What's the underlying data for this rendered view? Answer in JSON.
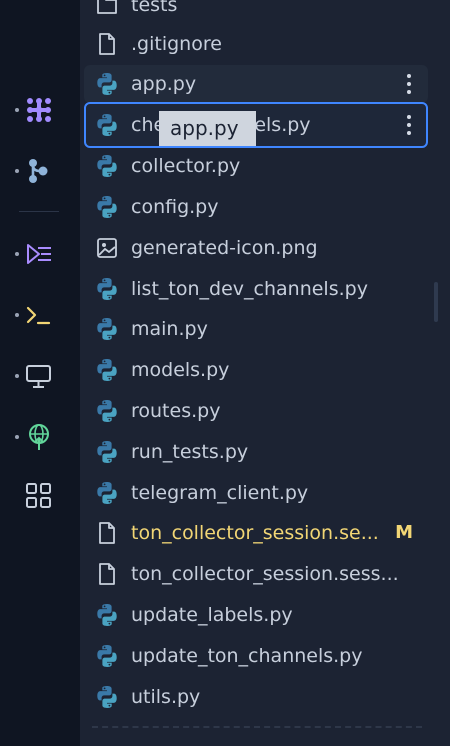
{
  "rail": {
    "items": [
      {
        "name": "agent-icon",
        "color": "#a18bff"
      },
      {
        "name": "git-icon",
        "color": "#8fb3d9"
      },
      {
        "name": "debugger-icon",
        "color": "#a98cff"
      },
      {
        "name": "shell-icon",
        "color": "#f2d675"
      },
      {
        "name": "console-icon",
        "color": "#c7cfdc"
      },
      {
        "name": "deployments-icon",
        "color": "#61d59a"
      },
      {
        "name": "all-tools-icon",
        "color": "#c7cfdc"
      }
    ]
  },
  "files": [
    {
      "name": "tests",
      "icon": "folder-icon"
    },
    {
      "name": ".gitignore",
      "icon": "file-icon"
    },
    {
      "name": "app.py",
      "icon": "python-icon",
      "state": "hovered"
    },
    {
      "name": "check_channels.py",
      "icon": "python-icon",
      "state": "selected"
    },
    {
      "name": "collector.py",
      "icon": "python-icon"
    },
    {
      "name": "config.py",
      "icon": "python-icon"
    },
    {
      "name": "generated-icon.png",
      "icon": "image-icon"
    },
    {
      "name": "list_ton_dev_channels.py",
      "icon": "python-icon"
    },
    {
      "name": "main.py",
      "icon": "python-icon"
    },
    {
      "name": "models.py",
      "icon": "python-icon"
    },
    {
      "name": "routes.py",
      "icon": "python-icon"
    },
    {
      "name": "run_tests.py",
      "icon": "python-icon"
    },
    {
      "name": "telegram_client.py",
      "icon": "python-icon"
    },
    {
      "name": "ton_collector_session.se...",
      "icon": "file-icon",
      "badge": "M"
    },
    {
      "name": "ton_collector_session.sess...",
      "icon": "file-icon"
    },
    {
      "name": "update_labels.py",
      "icon": "python-icon"
    },
    {
      "name": "update_ton_channels.py",
      "icon": "python-icon"
    },
    {
      "name": "utils.py",
      "icon": "python-icon"
    }
  ],
  "tooltip": {
    "text": "app.py"
  },
  "colors": {
    "accent": "#3f86ff",
    "modified": "#f2d675",
    "python_blue": "#3a79a8",
    "python_teal": "#4aa3c2"
  }
}
